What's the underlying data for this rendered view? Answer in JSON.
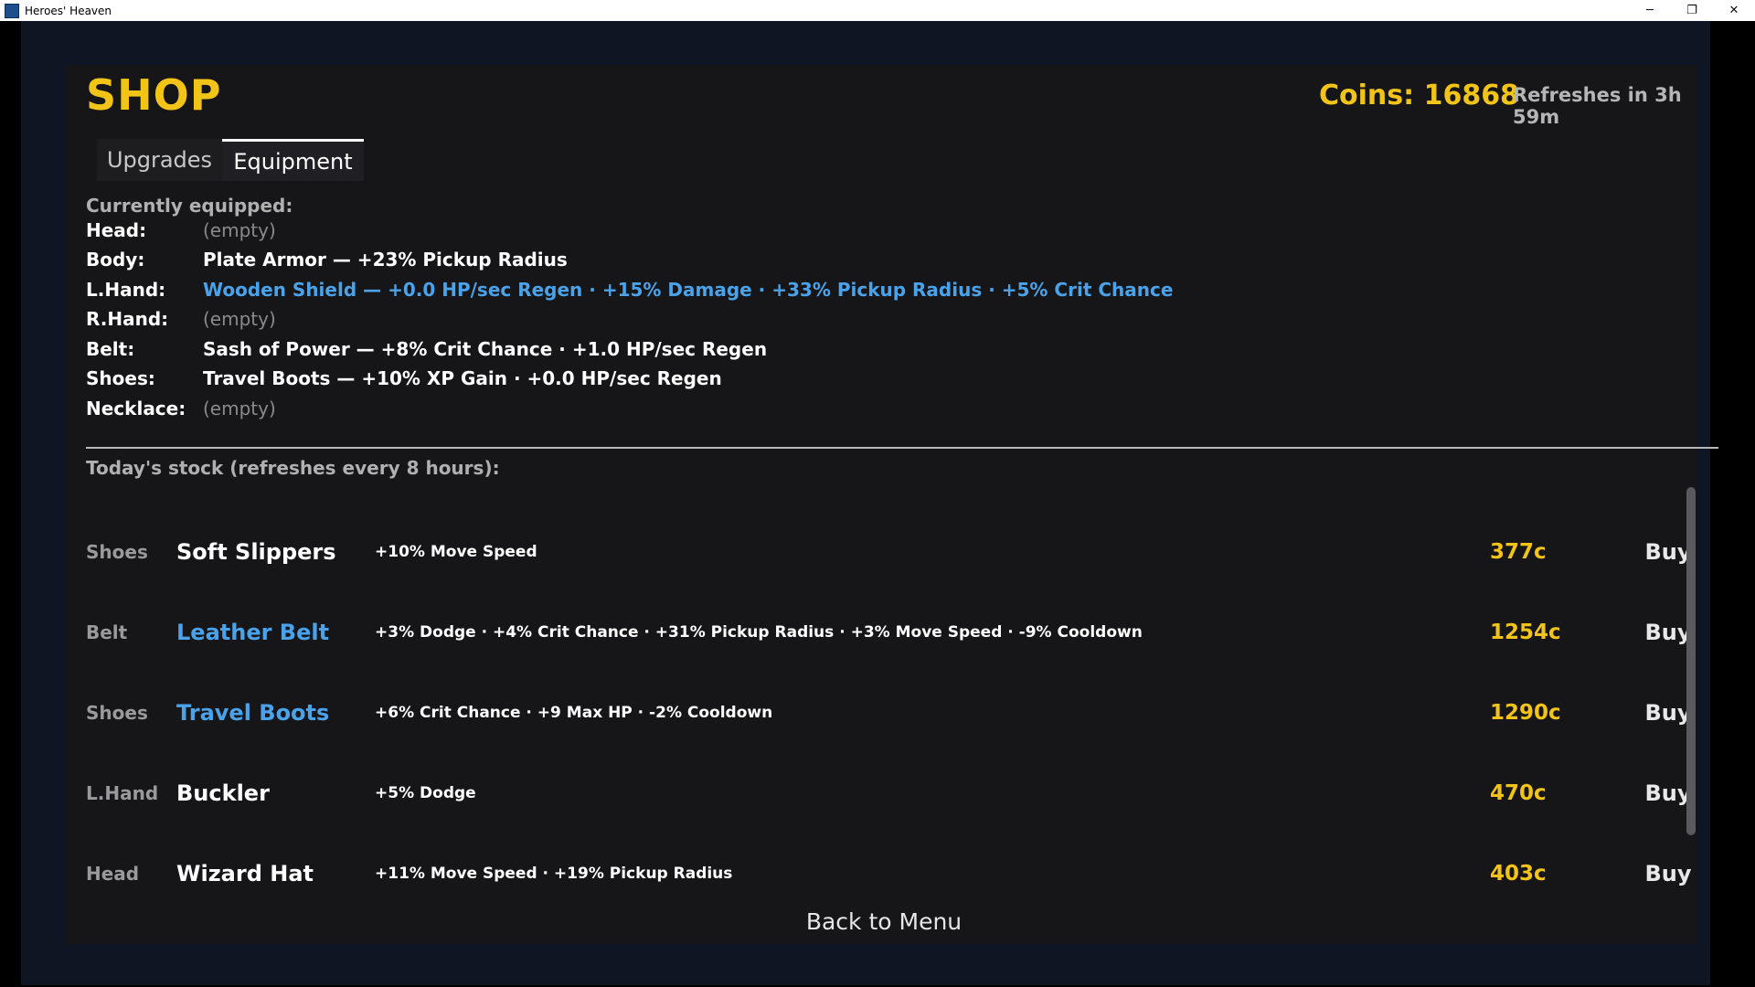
{
  "window": {
    "title": "Heroes' Heaven",
    "minimize_glyph": "─",
    "maximize_glyph": "❐",
    "close_glyph": "✕"
  },
  "header": {
    "title": "SHOP",
    "coins": "Coins: 16868",
    "refreshes": "Refreshes in 3h 59m"
  },
  "tabs": [
    {
      "label": "Upgrades",
      "active": false
    },
    {
      "label": "Equipment",
      "active": true
    }
  ],
  "equipped": {
    "header": "Currently equipped:",
    "slots": [
      {
        "label": "Head:",
        "value": "(empty)",
        "style": "empty"
      },
      {
        "label": "Body:",
        "value": "Plate Armor — +23% Pickup Radius",
        "style": "normal"
      },
      {
        "label": "L.Hand:",
        "value": "Wooden Shield — +0.0 HP/sec Regen  ·  +15% Damage  ·  +33% Pickup Radius  ·  +5% Crit Chance",
        "style": "blue"
      },
      {
        "label": "R.Hand:",
        "value": "(empty)",
        "style": "empty"
      },
      {
        "label": "Belt:",
        "value": "Sash of Power — +8% Crit Chance  ·  +1.0 HP/sec Regen",
        "style": "normal"
      },
      {
        "label": "Shoes:",
        "value": "Travel Boots — +10% XP Gain  ·  +0.0 HP/sec Regen",
        "style": "normal"
      },
      {
        "label": "Necklace:",
        "value": "(empty)",
        "style": "empty"
      }
    ]
  },
  "stock": {
    "header": "Today's stock (refreshes every 8 hours):",
    "buy_label": "Buy",
    "items": [
      {
        "slot": "Shoes",
        "name": "Soft Slippers",
        "rarity": "common",
        "stats": "+10% Move Speed",
        "price": "377c"
      },
      {
        "slot": "Belt",
        "name": "Leather Belt",
        "rarity": "rare",
        "stats": "+3% Dodge  ·  +4% Crit Chance  ·  +31% Pickup Radius  ·  +3% Move Speed  ·  -9% Cooldown",
        "price": "1254c"
      },
      {
        "slot": "Shoes",
        "name": "Travel Boots",
        "rarity": "rare",
        "stats": "+6% Crit Chance  ·  +9 Max HP  ·  -2% Cooldown",
        "price": "1290c"
      },
      {
        "slot": "L.Hand",
        "name": "Buckler",
        "rarity": "common",
        "stats": "+5% Dodge",
        "price": "470c"
      },
      {
        "slot": "Head",
        "name": "Wizard Hat",
        "rarity": "common",
        "stats": "+11% Move Speed  ·  +19% Pickup Radius",
        "price": "403c"
      }
    ]
  },
  "footer": {
    "back_label": "Back to Menu"
  },
  "colors": {
    "accent_gold": "#f2c418",
    "rare_blue": "#4aa3ea",
    "panel_bg": "#161618",
    "viewport_bg": "#0f1523"
  }
}
